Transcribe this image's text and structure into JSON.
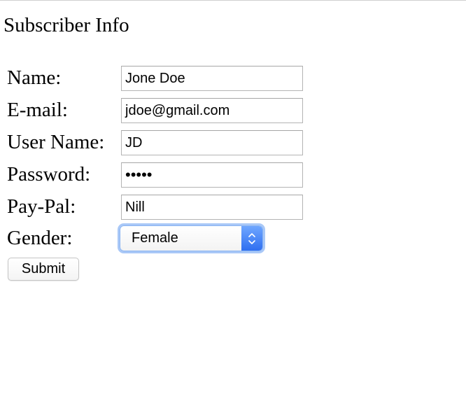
{
  "form": {
    "title": "Subscriber Info",
    "fields": {
      "name": {
        "label": "Name:",
        "value": "Jone Doe"
      },
      "email": {
        "label": "E-mail:",
        "value": "jdoe@gmail.com"
      },
      "username": {
        "label": "User Name:",
        "value": "JD"
      },
      "password": {
        "label": "Password:",
        "value": "•••••"
      },
      "paypal": {
        "label": "Pay-Pal:",
        "value": "Nill"
      },
      "gender": {
        "label": "Gender:",
        "selected": "Female"
      }
    },
    "submit_label": "Submit",
    "accent_color": "#3b7cf5"
  }
}
